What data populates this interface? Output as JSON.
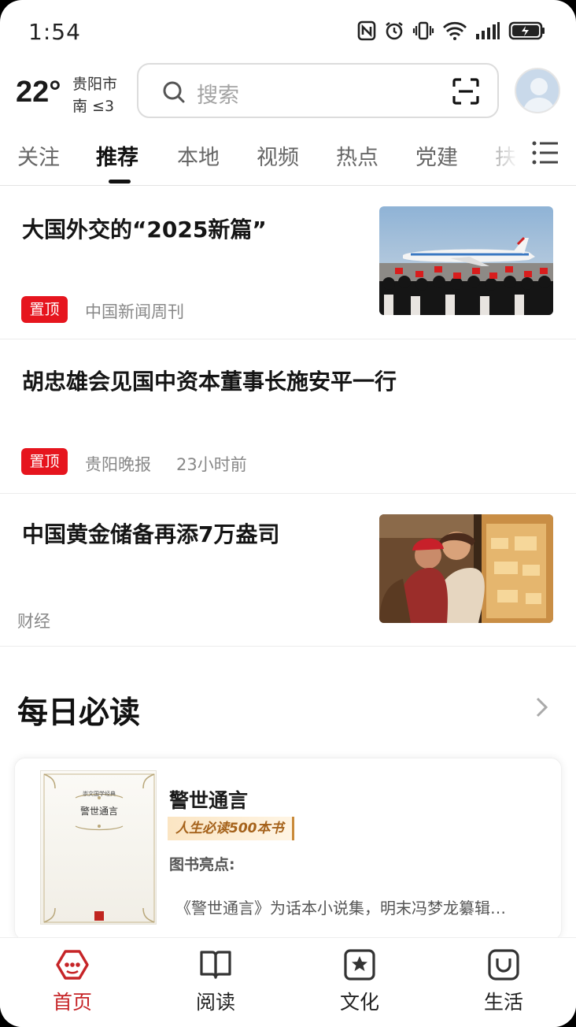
{
  "status_bar": {
    "time": "1:54"
  },
  "header": {
    "weather": {
      "temperature": "22°",
      "city": "贵阳市",
      "wind": "南  ≤3"
    },
    "search": {
      "placeholder": "搜索"
    }
  },
  "tabs": [
    {
      "label": "关注"
    },
    {
      "label": "推荐",
      "active": true
    },
    {
      "label": "本地"
    },
    {
      "label": "视频"
    },
    {
      "label": "热点"
    },
    {
      "label": "党建"
    },
    {
      "label": "扶"
    }
  ],
  "feed": [
    {
      "title": "大国外交的“2025新篇”",
      "badge": "置顶",
      "source": "中国新闻周刊",
      "time": "",
      "has_image": true
    },
    {
      "title": "胡忠雄会见国中资本董事长施安平一行",
      "badge": "置顶",
      "source": "贵阳晚报",
      "time": "23小时前",
      "has_image": false
    },
    {
      "title": "中国黄金储备再添7万盎司",
      "badge": "",
      "source": "财经",
      "time": "",
      "has_image": true
    }
  ],
  "daily": {
    "title": "每日必读",
    "book": {
      "cover_series": "崇文国学经典",
      "cover_title": "警世通言",
      "name": "警世通言",
      "tag": "人生必读500本书",
      "highlight_label": "图书亮点:",
      "description": "《警世通言》为话本小说集，明末冯梦龙纂辑…"
    }
  },
  "bottom_nav": [
    {
      "label": "首页",
      "icon": "home-icon",
      "active": true
    },
    {
      "label": "阅读",
      "icon": "book-icon"
    },
    {
      "label": "文化",
      "icon": "culture-icon"
    },
    {
      "label": "生活",
      "icon": "life-icon"
    }
  ],
  "colors": {
    "accent": "#e6151e",
    "nav_active": "#c62427"
  }
}
